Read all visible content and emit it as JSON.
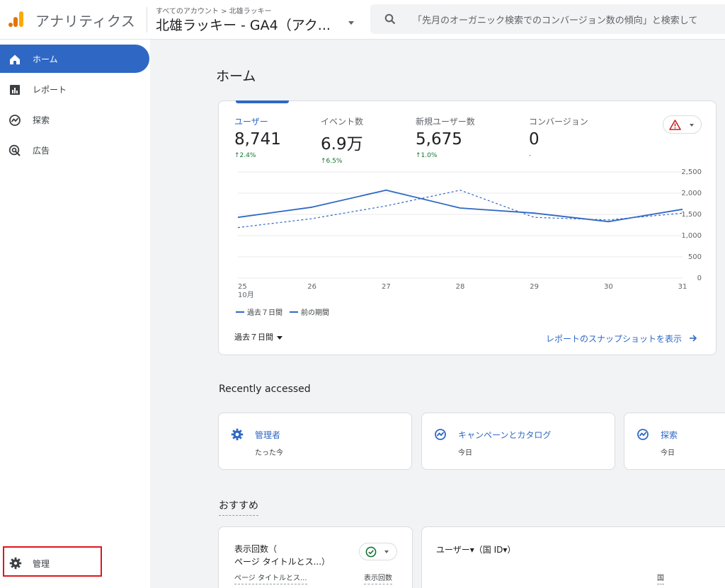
{
  "header": {
    "app_name": "アナリティクス",
    "breadcrumb": "すべてのアカウント > 北雄ラッキー",
    "property_name": "北雄ラッキー - GA4（アク...",
    "search_placeholder": "「先月のオーガニック検索でのコンバージョン数の傾向」と検索して"
  },
  "sidebar": {
    "items": [
      {
        "label": "ホーム",
        "icon": "home-icon"
      },
      {
        "label": "レポート",
        "icon": "reports-icon"
      },
      {
        "label": "探索",
        "icon": "explore-icon"
      },
      {
        "label": "広告",
        "icon": "advertising-icon"
      }
    ],
    "admin_label": "管理"
  },
  "main": {
    "page_title": "ホーム",
    "metrics": [
      {
        "label": "ユーザー",
        "value": "8,741",
        "change": "↑2.4%"
      },
      {
        "label": "イベント数",
        "value": "6.9万",
        "change": "↑6.5%"
      },
      {
        "label": "新規ユーザー数",
        "value": "5,675",
        "change": "↑1.0%"
      },
      {
        "label": "コンバージョン",
        "value": "0",
        "change": "-"
      }
    ],
    "legend": {
      "current": "過去７日間",
      "previous": "前の期間"
    },
    "date_range": "過去７日間",
    "snapshot_link": "レポートのスナップショットを表示",
    "recent_heading": "Recently accessed",
    "recent": [
      {
        "title": "管理者",
        "time": "たった今",
        "icon": "gear-icon"
      },
      {
        "title": "キャンペーンとカタログ",
        "time": "今日",
        "icon": "explore-icon"
      },
      {
        "title": "探索",
        "time": "今日",
        "icon": "explore-icon"
      }
    ],
    "recommend_heading": "おすすめ",
    "rec_card1": {
      "title_line1": "表示回数（",
      "title_line2": "ページ タイトルとス...）",
      "col1": "ページ タイトルとス...",
      "col2": "表示回数"
    },
    "rec_card2": {
      "title": "ユーザー▾（国 ID▾）",
      "col": "国"
    }
  },
  "colors": {
    "accent": "#2f68c4",
    "positive": "#137333",
    "highlight_box": "#e0161b"
  },
  "chart_data": {
    "type": "line",
    "x": [
      "25",
      "26",
      "27",
      "28",
      "29",
      "30",
      "31"
    ],
    "x_sublabel": "10月",
    "y_ticks": [
      "2,500",
      "2,000",
      "1,500",
      "1,000",
      "500",
      "0"
    ],
    "ylim": [
      0,
      2500
    ],
    "series": [
      {
        "name": "過去７日間",
        "style": "solid",
        "values": [
          1430,
          1670,
          2070,
          1650,
          1530,
          1330,
          1620
        ]
      },
      {
        "name": "前の期間",
        "style": "dashed",
        "values": [
          1190,
          1400,
          1700,
          2070,
          1430,
          1370,
          1530
        ]
      }
    ],
    "grid": true
  }
}
